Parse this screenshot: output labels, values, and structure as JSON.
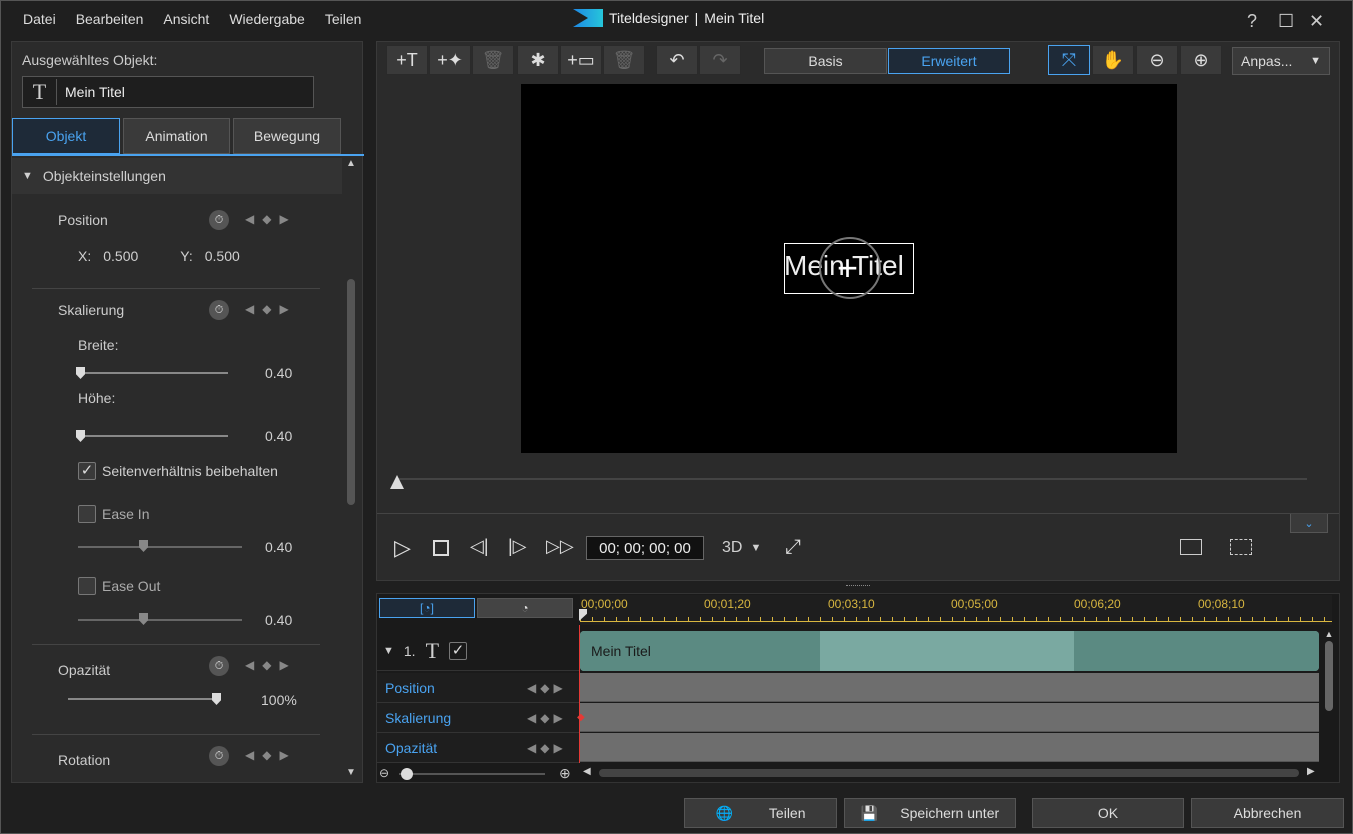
{
  "menu": [
    "Datei",
    "Bearbeiten",
    "Ansicht",
    "Wiedergabe",
    "Teilen"
  ],
  "window": {
    "app": "Titeldesigner",
    "separator": "|",
    "doc": "Mein Titel",
    "help": "?",
    "maximize": "☐",
    "close": "✕"
  },
  "left": {
    "selected_label": "Ausgewähltes Objekt:",
    "selected_value": "Mein Titel",
    "tabs": [
      "Objekt",
      "Animation",
      "Bewegung"
    ],
    "section": "Objekteinstellungen",
    "position": {
      "label": "Position",
      "x_label": "X:",
      "x": "0.500",
      "y_label": "Y:",
      "y": "0.500"
    },
    "scaling": {
      "label": "Skalierung",
      "width_label": "Breite:",
      "width": "0.40",
      "height_label": "Höhe:",
      "height": "0.40",
      "aspect": "Seitenverhältnis beibehalten",
      "ease_in": "Ease In",
      "ease_in_val": "0.40",
      "ease_out": "Ease Out",
      "ease_out_val": "0.40"
    },
    "opacity": {
      "label": "Opazität",
      "value": "100%"
    },
    "rotation": {
      "label": "Rotation"
    }
  },
  "toolbar": {
    "basis": "Basis",
    "erweitert": "Erweitert",
    "fit": "Anpas..."
  },
  "preview": {
    "text": "Mein Titel"
  },
  "playback": {
    "timecode": "00; 00; 00; 00",
    "mode": "3D"
  },
  "timeline": {
    "ticks": [
      "00;00;00",
      "00;01;20",
      "00;03;10",
      "00;05;00",
      "00;06;20",
      "00;08;10"
    ],
    "track_number": "1.",
    "clip": "Mein Titel",
    "rows": [
      "Position",
      "Skalierung",
      "Opazität"
    ]
  },
  "footer": {
    "share": "Teilen",
    "save_as": "Speichern unter",
    "ok": "OK",
    "cancel": "Abbrechen"
  }
}
